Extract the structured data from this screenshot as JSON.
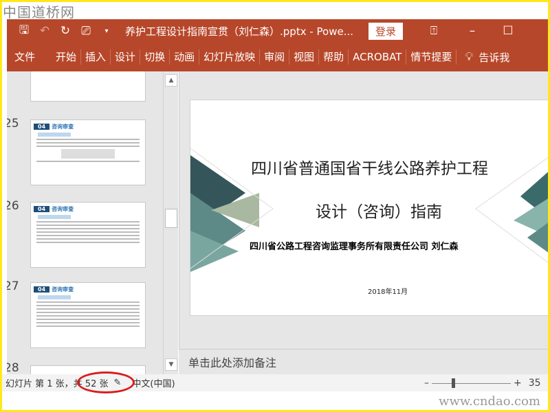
{
  "watermark_top": "中国道桥网",
  "watermark_bottom": "www.cndao.com",
  "titlebar": {
    "title": "养护工程设计指南宣贯（刘仁森）.pptx  -  Powe...",
    "login": "登录",
    "icons": [
      "save-icon",
      "undo-icon",
      "redo-icon",
      "present-icon",
      "customize-icon"
    ]
  },
  "ribbon": {
    "tabs": [
      "文件",
      "开始",
      "插入",
      "设计",
      "切换",
      "动画",
      "幻灯片放映",
      "审阅",
      "视图",
      "帮助",
      "ACROBAT",
      "情节提要"
    ],
    "tell_me": "告诉我"
  },
  "thumbnails": [
    {
      "num": "25",
      "chapter": "04",
      "heading": "咨询审查"
    },
    {
      "num": "26",
      "chapter": "04",
      "heading": "咨询审查"
    },
    {
      "num": "27",
      "chapter": "04",
      "heading": "咨询审查"
    },
    {
      "num": "28"
    }
  ],
  "slide": {
    "title1": "四川省普通国省干线公路养护工程",
    "title2": "设计（咨询）指南",
    "author": "四川省公路工程咨询监理事务所有限责任公司  刘仁森",
    "date": "2018年11月"
  },
  "notes_placeholder": "单击此处添加备注",
  "status": {
    "slide_info": "幻灯片 第 1 张，共 52 张",
    "language": "中文(中国)",
    "zoom": "35",
    "zoom_fraction": 0.25
  },
  "colors": {
    "accent": "#b7472a",
    "highlight": "#d91c1c"
  }
}
